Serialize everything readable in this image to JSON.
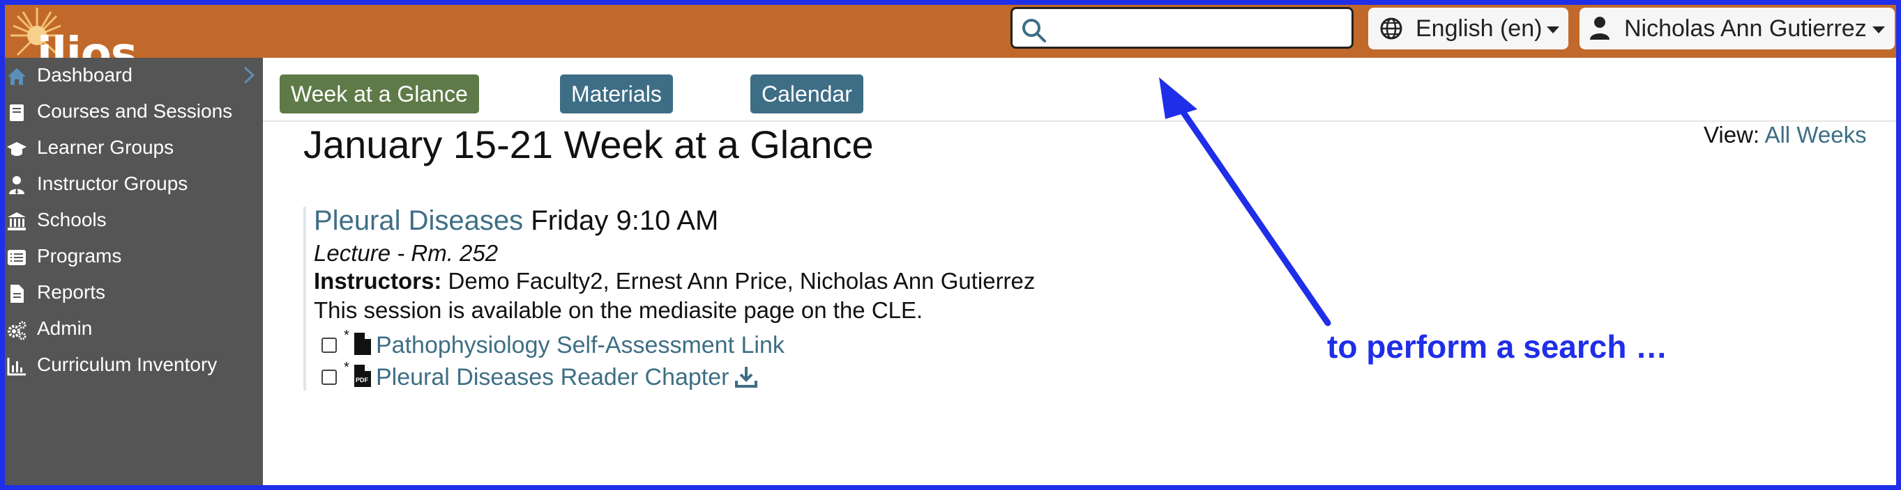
{
  "app": {
    "logo_text": "ilios"
  },
  "header": {
    "search": {
      "value": "",
      "placeholder": ""
    },
    "language": {
      "label": "English (en)"
    },
    "user": {
      "label": "Nicholas Ann Gutierrez"
    }
  },
  "sidebar": {
    "items": [
      {
        "label": "Dashboard",
        "icon": "home-icon"
      },
      {
        "label": "Courses and Sessions",
        "icon": "book-icon"
      },
      {
        "label": "Learner Groups",
        "icon": "graduation-cap-icon"
      },
      {
        "label": "Instructor Groups",
        "icon": "user-tie-icon"
      },
      {
        "label": "Schools",
        "icon": "university-icon"
      },
      {
        "label": "Programs",
        "icon": "list-alt-icon"
      },
      {
        "label": "Reports",
        "icon": "file-alt-icon"
      },
      {
        "label": "Admin",
        "icon": "cogs-icon"
      },
      {
        "label": "Curriculum Inventory",
        "icon": "chart-bar-icon"
      }
    ]
  },
  "main": {
    "tabs": [
      {
        "label": "Week at a Glance",
        "active": true
      },
      {
        "label": "Materials",
        "active": false
      },
      {
        "label": "Calendar",
        "active": false
      }
    ],
    "title": "January 15-21 Week at a Glance",
    "view": {
      "label": "View:",
      "link": "All Weeks"
    },
    "event": {
      "title_link": "Pleural Diseases",
      "time": "Friday 9:10 AM",
      "type_location": "Lecture - Rm. 252",
      "instructors_label": "Instructors:",
      "instructors": "Demo Faculty2, Ernest Ann Price, Nicholas Ann Gutierrez",
      "description": "This session is available on the mediasite page on the CLE.",
      "materials": [
        {
          "label": "Pathophysiology Self-Assessment Link",
          "star": "*",
          "icon": "file-icon",
          "download": false
        },
        {
          "label": "Pleural Diseases Reader Chapter",
          "star": "*",
          "icon": "file-pdf-icon",
          "download": true
        }
      ]
    }
  },
  "annotation": {
    "text": "to perform a search …"
  },
  "colors": {
    "header": "#c1692a",
    "sidebar": "#555555",
    "tab_active": "#5e7a48",
    "tab": "#3e6e85",
    "link": "#3e6e85",
    "annotation": "#1f2ee8"
  }
}
